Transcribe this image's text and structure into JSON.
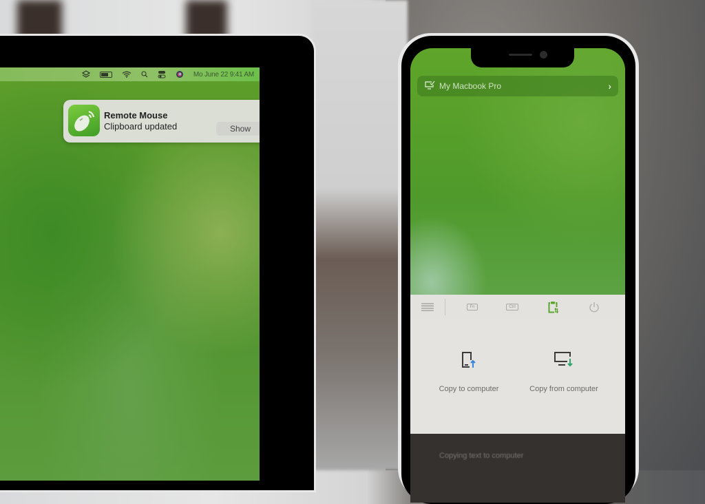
{
  "mac": {
    "menubar": {
      "icons": [
        "stack-icon",
        "battery-icon",
        "wifi-icon",
        "search-icon",
        "control-center-icon",
        "siri-icon"
      ],
      "datetime": "Mo June 22  9:41 AM"
    },
    "notification": {
      "app_icon": "remote-mouse-icon",
      "title": "Remote Mouse",
      "message": "Clipboard updated",
      "action_label": "Show"
    }
  },
  "phone": {
    "device_selector": {
      "icon": "computer-check-icon",
      "name": "My Macbook Pro",
      "chevron": "›"
    },
    "toolbar": {
      "items": [
        {
          "icon": "menu-icon"
        },
        {
          "icon": "fn-key-icon",
          "label": "Fn"
        },
        {
          "icon": "ctrl-key-icon",
          "label": "Ctrl"
        },
        {
          "icon": "clipboard-sync-icon",
          "active": true
        },
        {
          "icon": "power-icon"
        }
      ],
      "active_color": "#5aa52c"
    },
    "actions": [
      {
        "icon": "phone-upload-icon",
        "label": "Copy to computer",
        "accent": "#3b82e0"
      },
      {
        "icon": "computer-download-icon",
        "label": "Copy from computer",
        "accent": "#2ea36a"
      }
    ],
    "status_toast": "Copying text to computer"
  }
}
